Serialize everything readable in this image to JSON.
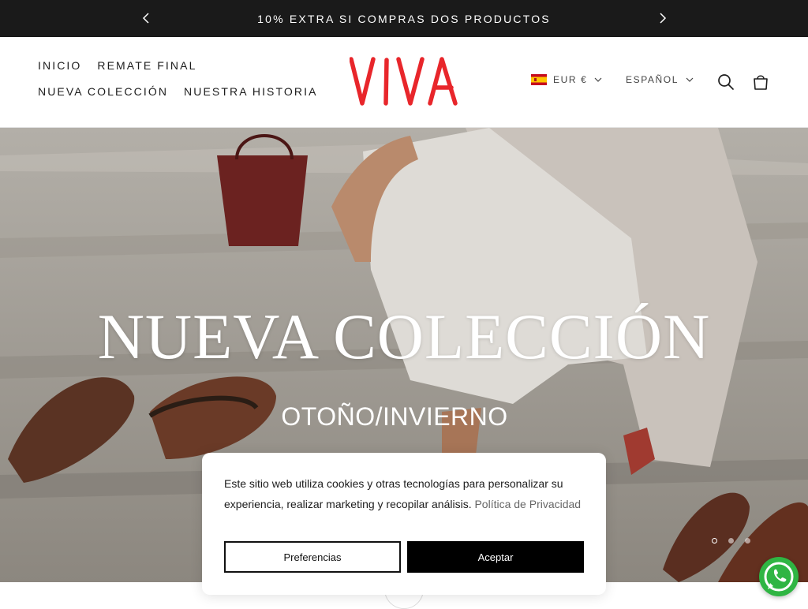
{
  "announcement": {
    "text": "10% EXTRA SI COMPRAS DOS PRODUCTOS",
    "prev_icon": "chevron-left-icon",
    "next_icon": "chevron-right-icon"
  },
  "header": {
    "nav": [
      {
        "label": "INICIO"
      },
      {
        "label": "REMATE FINAL"
      },
      {
        "label": "NUEVA COLECCIÓN"
      },
      {
        "label": "NUESTRA HISTORIA"
      }
    ],
    "logo_text": "VIVA",
    "logo_color": "#e8262b",
    "currency": {
      "label": "EUR €",
      "flag": "spain-flag-icon"
    },
    "language": {
      "label": "ESPAÑOL"
    },
    "icons": [
      "search-icon",
      "shopping-bag-icon"
    ]
  },
  "hero": {
    "title": "NUEVA COLECCIÓN",
    "subtitle": "OTOÑO/INVIERNO",
    "slides": 3,
    "active_slide": 1
  },
  "cookie_banner": {
    "text": "Este sitio web utiliza cookies y otras tecnologías para personalizar su experiencia, realizar marketing y recopilar análisis.",
    "link_text": "Política de Privacidad",
    "preferences_label": "Preferencias",
    "accept_label": "Aceptar"
  },
  "whatsapp": {
    "icon": "whatsapp-icon",
    "color": "#2fb543"
  }
}
